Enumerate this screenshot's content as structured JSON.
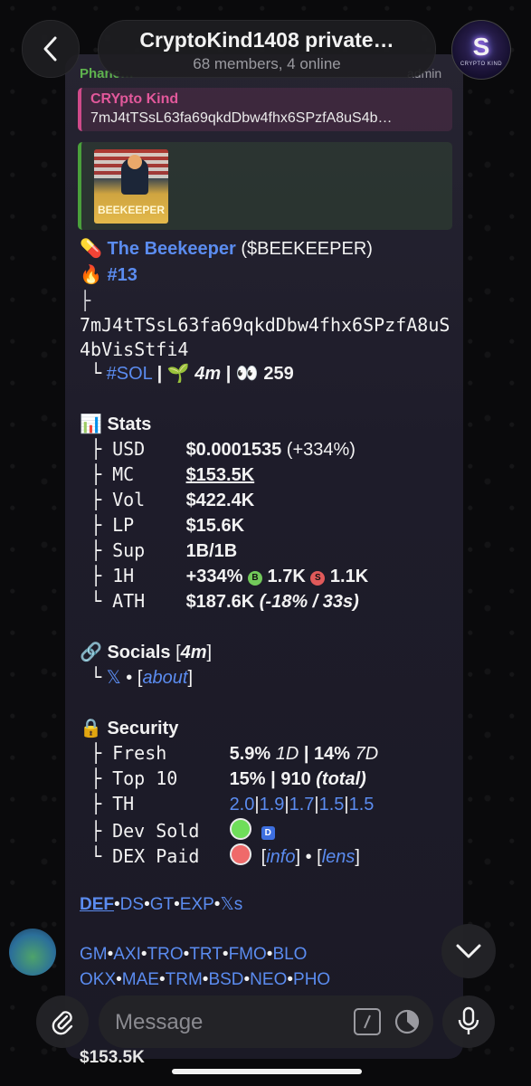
{
  "header": {
    "title": "CryptoKind1408 private…",
    "subtitle": "68 members, 4 online",
    "avatar_letter": "S",
    "avatar_caption": "CRYPTO KIND"
  },
  "message": {
    "sender_name": "Phane…",
    "sender_role": "admin",
    "reply": {
      "name": "CRYpto Kind",
      "text": "7mJ4tTSsL63fa69qkdDbw4fhx6SPzfA8uS4b…"
    },
    "poster_text": "BEEKEEPER",
    "token": {
      "icon": "💊",
      "name": "The Beekeeper",
      "ticker": "($BEEKEEPER)",
      "rank_icon": "🔥",
      "rank": "#13",
      "tree_top": "├",
      "address_line1": "7mJ4tTSsL63fa69qkdDbw4fhx6SPzfA8uS",
      "address_line2": "4bVisStfi4",
      "tree_bottom": "└",
      "chain": "#SOL",
      "age_icon": "🌱",
      "age": "4m",
      "holders_icon": "👀",
      "holders": "259"
    },
    "stats": {
      "icon": "📊",
      "title": "Stats",
      "usd_label": "USD",
      "usd": "$0.0001535",
      "usd_change": "(+334%)",
      "mc_label": "MC",
      "mc": "$153.5K",
      "vol_label": "Vol",
      "vol": "$422.4K",
      "lp_label": "LP",
      "lp": "$15.6K",
      "sup_label": "Sup",
      "sup": "1B/1B",
      "h1_label": "1H",
      "h1": "+334%",
      "buys_badge": "B",
      "buys": "1.7K",
      "sells_badge": "S",
      "sells": "1.1K",
      "ath_label": "ATH",
      "ath": "$187.6K",
      "ath_note": "(-18% / 33s)"
    },
    "socials": {
      "icon": "🔗",
      "title": "Socials",
      "age": "4m",
      "x_icon": "𝕏",
      "bullet": "•",
      "about": "about"
    },
    "security": {
      "icon": "🔒",
      "title": "Security",
      "fresh_label": "Fresh",
      "fresh_1d": "5.9%",
      "fresh_1d_tag": "1D",
      "fresh_7d": "14%",
      "fresh_7d_tag": "7D",
      "top10_label": "Top 10",
      "top10_pct": "15%",
      "top10_total": "910",
      "top10_tag": "(total)",
      "th_label": "TH",
      "th_values": [
        "2.0",
        "1.9",
        "1.7",
        "1.5",
        "1.5"
      ],
      "dev_label": "Dev Sold",
      "dev_badge": "D",
      "dex_label": "DEX Paid",
      "info": "info",
      "lens": "lens"
    },
    "links_row1": [
      "DEF",
      "DS",
      "GT",
      "EXP",
      "𝕏s"
    ],
    "links_row2": [
      "GM",
      "AXI",
      "TRO",
      "TRT",
      "FMO",
      "BLO"
    ],
    "links_row3": [
      "OKX",
      "MAE",
      "TRM",
      "BSD",
      "NEO",
      "PHO"
    ],
    "next_preview": "$153.5K"
  },
  "composer": {
    "placeholder": "Message"
  },
  "colors": {
    "link": "#5b8cf0",
    "green": "#5fb34e",
    "reply_pink": "#e2589b"
  }
}
